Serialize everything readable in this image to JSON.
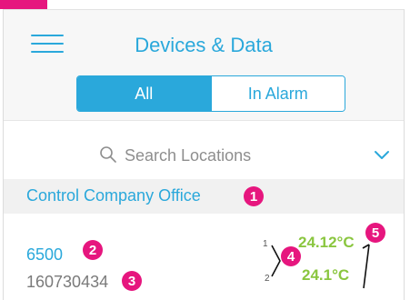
{
  "header": {
    "title": "Devices & Data"
  },
  "filter": {
    "all_label": "All",
    "alarm_label": "In Alarm"
  },
  "search": {
    "placeholder": "Search Locations"
  },
  "location": {
    "name": "Control Company Office"
  },
  "device": {
    "name": "6500",
    "serial": "160730434",
    "channels": [
      {
        "number": "1",
        "reading": "24.12°C"
      },
      {
        "number": "2",
        "reading": "24.1°C"
      }
    ]
  },
  "callouts": [
    "1",
    "2",
    "3",
    "4",
    "5"
  ],
  "colors": {
    "accent": "#2aa8db",
    "reading": "#8ac63f",
    "callout": "#e6167e"
  },
  "icons": {
    "menu": "hamburger-menu-icon",
    "search": "search-icon",
    "expand": "chevron-down-icon"
  }
}
